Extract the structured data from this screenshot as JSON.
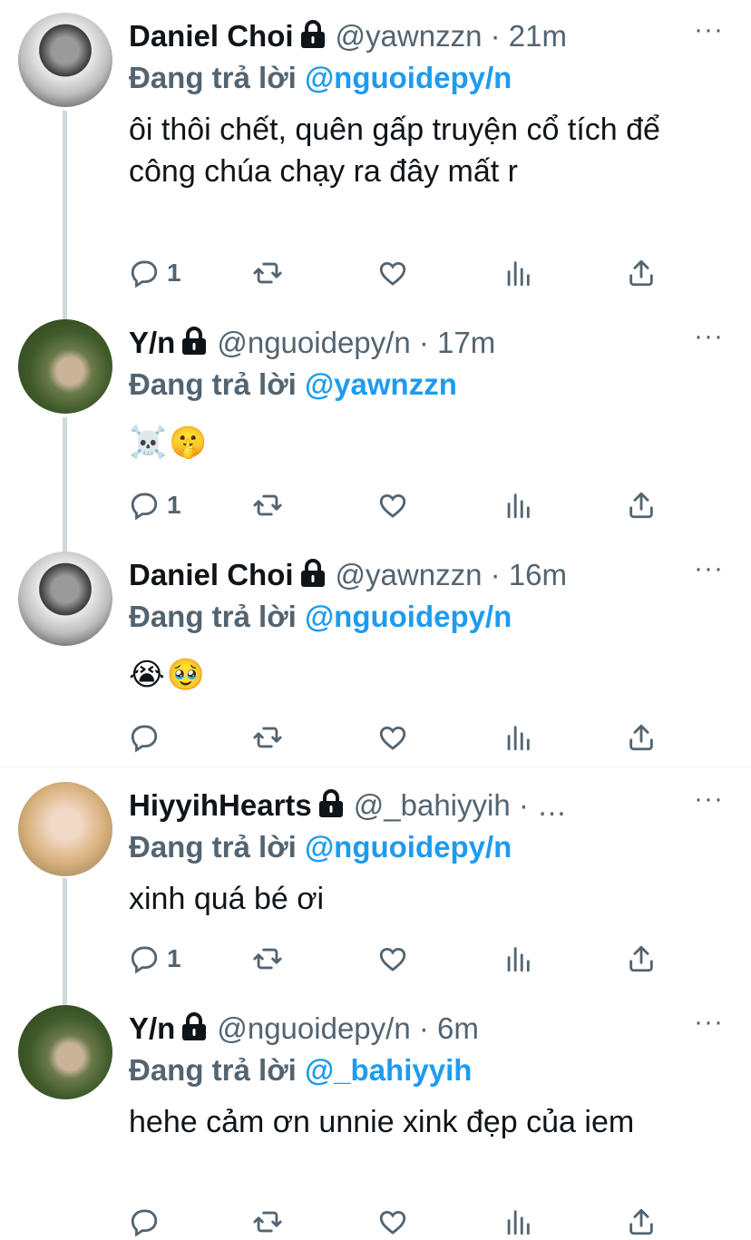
{
  "tweets": [
    {
      "avatar": "dark",
      "name": "Daniel Choi",
      "handle": "@yawnzzn",
      "time": "21m",
      "reply_prefix": "Đang trả lời ",
      "reply_to": "@nguoidepy/n",
      "text": "ôi thôi chết, quên gấp truyện cổ tích để công chúa chạy ra đây mất r",
      "reply_count": "1"
    },
    {
      "avatar": "green",
      "name": "Y/n",
      "handle": "@nguoidepy/n",
      "time": "17m",
      "reply_prefix": "Đang trả lời ",
      "reply_to": "@yawnzzn",
      "emoji": "☠️🤫",
      "reply_count": "1"
    },
    {
      "avatar": "dark",
      "name": "Daniel Choi",
      "handle": "@yawnzzn",
      "time": "16m",
      "reply_prefix": "Đang trả lời ",
      "reply_to": "@nguoidepy/n",
      "emoji": "😭🥹",
      "reply_count": ""
    },
    {
      "avatar": "blonde",
      "name": "HiyyihHearts",
      "handle": "@_bahiyyih",
      "time": "…",
      "reply_prefix": "Đang trả lời ",
      "reply_to": "@nguoidepy/n",
      "text": "xinh quá bé ơi",
      "reply_count": "1"
    },
    {
      "avatar": "green",
      "name": "Y/n",
      "handle": "@nguoidepy/n",
      "time": "6m",
      "reply_prefix": "Đang trả lời ",
      "reply_to": "@_bahiyyih",
      "text": "hehe cảm ơn unnie xink đẹp của iem",
      "reply_count": ""
    }
  ],
  "separator": " · ",
  "more_glyph": "···",
  "icons": {
    "reply": "reply-icon",
    "retweet": "retweet-icon",
    "like": "heart-icon",
    "views": "analytics-icon",
    "share": "share-icon",
    "lock": "lock-icon",
    "more": "more-icon"
  },
  "colors": {
    "accent": "#1d9bf0",
    "secondary": "#536471",
    "text": "#0f1419",
    "thread_line": "#cfd9de"
  }
}
